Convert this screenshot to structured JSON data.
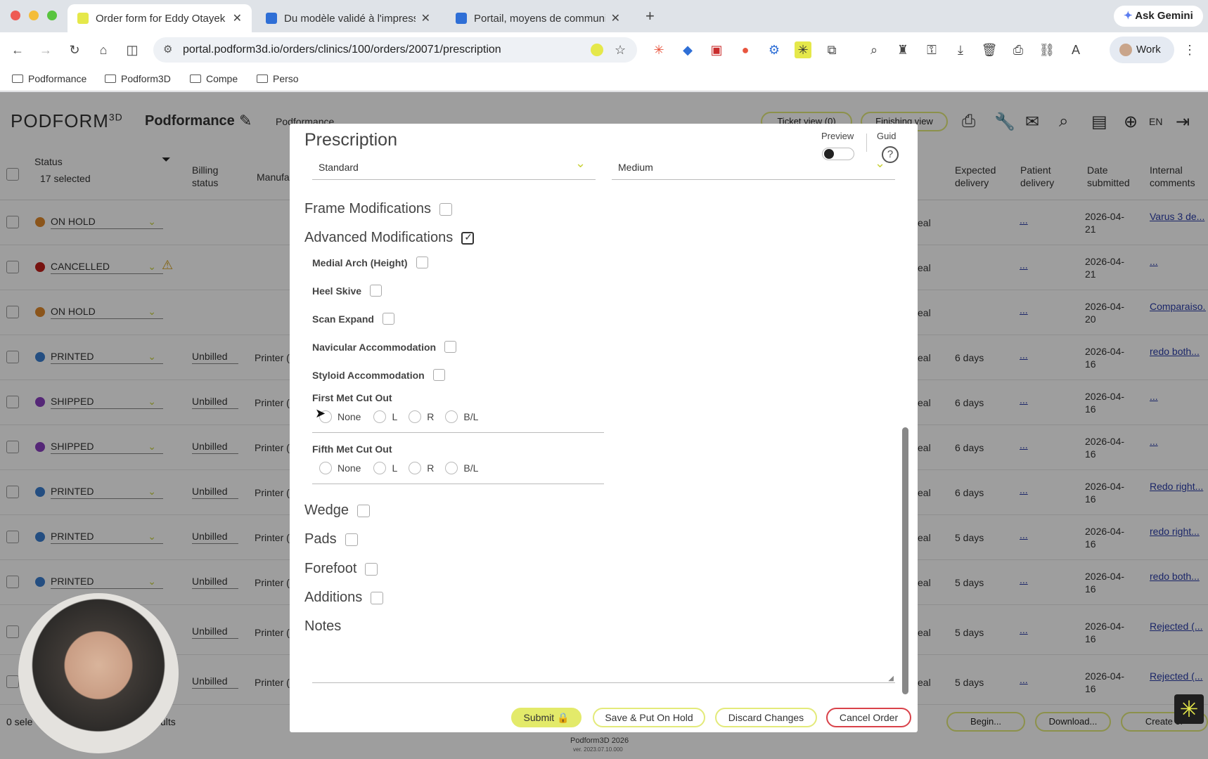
{
  "browser": {
    "tabs": [
      {
        "title": "Order form for Eddy Otayek |",
        "active": true
      },
      {
        "title": "Du modèle validé à l'impressi",
        "active": false
      },
      {
        "title": "Portail, moyens de communic",
        "active": false
      }
    ],
    "new_tab": "+",
    "ask_gemini": "Ask Gemini",
    "url": "portal.podform3d.io/orders/clinics/100/orders/20071/prescription",
    "profile": "Work",
    "bookmarks": [
      "Podformance",
      "Podform3D",
      "Compe",
      "Perso"
    ]
  },
  "app": {
    "logo": "PODFORM",
    "logo_sup": "3D",
    "clinic": "Podformance",
    "clinic_select": "Podformance",
    "ticket_view": "Ticket view (0)",
    "finishing_view": "Finishing view",
    "lang": "EN",
    "columns": {
      "status": "Status",
      "status_filter": "17 selected",
      "billing": "Billing status",
      "manufacturer": "Manufa",
      "expected": "Expected delivery",
      "patient": "Patient delivery",
      "date": "Date submitted",
      "comments": "Internal comments"
    },
    "rows": [
      {
        "status": "ON HOLD",
        "color": "#e08a2c",
        "billing": "",
        "printer": "",
        "type": "eal",
        "expected": "",
        "patient": "...",
        "date": "2026-04-21",
        "comment": "Varus 3 de..."
      },
      {
        "status": "CANCELLED",
        "color": "#c0201b",
        "billing": "",
        "printer": "",
        "type": "eal",
        "expected": "",
        "patient": "...",
        "date": "2026-04-21",
        "comment": "..."
      },
      {
        "status": "ON HOLD",
        "color": "#e08a2c",
        "billing": "",
        "printer": "",
        "type": "eal",
        "expected": "",
        "patient": "...",
        "date": "2026-04-20",
        "comment": "Comparaiso..."
      },
      {
        "status": "PRINTED",
        "color": "#3b7fd0",
        "billing": "Unbilled",
        "printer": "Printer (",
        "type": "eal",
        "expected": "6 days",
        "patient": "...",
        "date": "2026-04-16",
        "comment": "redo both..."
      },
      {
        "status": "SHIPPED",
        "color": "#8a3fc0",
        "billing": "Unbilled",
        "printer": "Printer (",
        "type": "eal",
        "expected": "6 days",
        "patient": "...",
        "date": "2026-04-16",
        "comment": "..."
      },
      {
        "status": "SHIPPED",
        "color": "#8a3fc0",
        "billing": "Unbilled",
        "printer": "Printer (",
        "type": "eal",
        "expected": "6 days",
        "patient": "...",
        "date": "2026-04-16",
        "comment": "..."
      },
      {
        "status": "PRINTED",
        "color": "#3b7fd0",
        "billing": "Unbilled",
        "printer": "Printer (",
        "type": "eal",
        "expected": "6 days",
        "patient": "...",
        "date": "2026-04-16",
        "comment": "Redo right..."
      },
      {
        "status": "PRINTED",
        "color": "#3b7fd0",
        "billing": "Unbilled",
        "printer": "Printer (",
        "type": "eal",
        "expected": "5 days",
        "patient": "...",
        "date": "2026-04-16",
        "comment": "redo right..."
      },
      {
        "status": "PRINTED",
        "color": "#3b7fd0",
        "billing": "Unbilled",
        "printer": "Printer (",
        "type": "eal",
        "expected": "5 days",
        "patient": "...",
        "date": "2026-04-16",
        "comment": "redo both..."
      },
      {
        "status": "",
        "color": "",
        "billing": "Unbilled",
        "printer": "Printer (",
        "type": "eal",
        "expected": "5 days",
        "patient": "...",
        "date": "2026-04-16",
        "comment": "Rejected (..."
      },
      {
        "status": "",
        "color": "",
        "billing": "Unbilled",
        "printer": "Printer (",
        "type": "eal",
        "expected": "5 days",
        "patient": "...",
        "date": "2026-04-16",
        "comment": "Rejected (..."
      }
    ],
    "footer": {
      "selected": "0 sele",
      "results": "ults",
      "begin": "Begin...",
      "download": "Download...",
      "create": "Create or",
      "copyright": "Podform3D 2026",
      "version": "ver. 2023.07.10.000"
    }
  },
  "modal": {
    "title": "Prescription",
    "preview_label": "Preview",
    "guide_label": "Guid",
    "select_left": "Standard",
    "select_right": "Medium",
    "frame_mods": "Frame Modifications",
    "advanced_mods": "Advanced Modifications",
    "sub_options": [
      "Medial Arch (Height)",
      "Heel Skive",
      "Scan Expand",
      "Navicular Accommodation",
      "Styloid Accommodation"
    ],
    "first_met": {
      "label": "First Met Cut Out",
      "options": [
        "None",
        "L",
        "R",
        "B/L"
      ]
    },
    "fifth_met": {
      "label": "Fifth Met Cut Out",
      "options": [
        "None",
        "L",
        "R",
        "B/L"
      ]
    },
    "wedge": "Wedge",
    "pads": "Pads",
    "forefoot": "Forefoot",
    "additions": "Additions",
    "notes": "Notes",
    "buttons": {
      "submit": "Submit",
      "save_hold": "Save & Put On Hold",
      "discard": "Discard Changes",
      "cancel": "Cancel Order"
    }
  }
}
